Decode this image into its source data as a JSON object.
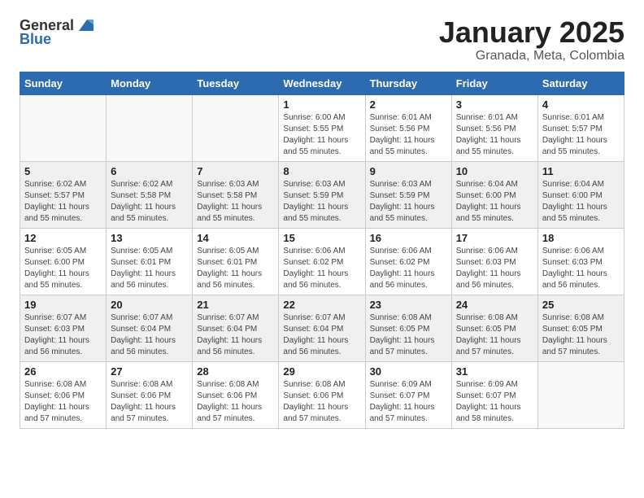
{
  "header": {
    "logo_general": "General",
    "logo_blue": "Blue",
    "month": "January 2025",
    "location": "Granada, Meta, Colombia"
  },
  "weekdays": [
    "Sunday",
    "Monday",
    "Tuesday",
    "Wednesday",
    "Thursday",
    "Friday",
    "Saturday"
  ],
  "weeks": [
    [
      {
        "day": "",
        "info": ""
      },
      {
        "day": "",
        "info": ""
      },
      {
        "day": "",
        "info": ""
      },
      {
        "day": "1",
        "info": "Sunrise: 6:00 AM\nSunset: 5:55 PM\nDaylight: 11 hours\nand 55 minutes."
      },
      {
        "day": "2",
        "info": "Sunrise: 6:01 AM\nSunset: 5:56 PM\nDaylight: 11 hours\nand 55 minutes."
      },
      {
        "day": "3",
        "info": "Sunrise: 6:01 AM\nSunset: 5:56 PM\nDaylight: 11 hours\nand 55 minutes."
      },
      {
        "day": "4",
        "info": "Sunrise: 6:01 AM\nSunset: 5:57 PM\nDaylight: 11 hours\nand 55 minutes."
      }
    ],
    [
      {
        "day": "5",
        "info": "Sunrise: 6:02 AM\nSunset: 5:57 PM\nDaylight: 11 hours\nand 55 minutes."
      },
      {
        "day": "6",
        "info": "Sunrise: 6:02 AM\nSunset: 5:58 PM\nDaylight: 11 hours\nand 55 minutes."
      },
      {
        "day": "7",
        "info": "Sunrise: 6:03 AM\nSunset: 5:58 PM\nDaylight: 11 hours\nand 55 minutes."
      },
      {
        "day": "8",
        "info": "Sunrise: 6:03 AM\nSunset: 5:59 PM\nDaylight: 11 hours\nand 55 minutes."
      },
      {
        "day": "9",
        "info": "Sunrise: 6:03 AM\nSunset: 5:59 PM\nDaylight: 11 hours\nand 55 minutes."
      },
      {
        "day": "10",
        "info": "Sunrise: 6:04 AM\nSunset: 6:00 PM\nDaylight: 11 hours\nand 55 minutes."
      },
      {
        "day": "11",
        "info": "Sunrise: 6:04 AM\nSunset: 6:00 PM\nDaylight: 11 hours\nand 55 minutes."
      }
    ],
    [
      {
        "day": "12",
        "info": "Sunrise: 6:05 AM\nSunset: 6:00 PM\nDaylight: 11 hours\nand 55 minutes."
      },
      {
        "day": "13",
        "info": "Sunrise: 6:05 AM\nSunset: 6:01 PM\nDaylight: 11 hours\nand 56 minutes."
      },
      {
        "day": "14",
        "info": "Sunrise: 6:05 AM\nSunset: 6:01 PM\nDaylight: 11 hours\nand 56 minutes."
      },
      {
        "day": "15",
        "info": "Sunrise: 6:06 AM\nSunset: 6:02 PM\nDaylight: 11 hours\nand 56 minutes."
      },
      {
        "day": "16",
        "info": "Sunrise: 6:06 AM\nSunset: 6:02 PM\nDaylight: 11 hours\nand 56 minutes."
      },
      {
        "day": "17",
        "info": "Sunrise: 6:06 AM\nSunset: 6:03 PM\nDaylight: 11 hours\nand 56 minutes."
      },
      {
        "day": "18",
        "info": "Sunrise: 6:06 AM\nSunset: 6:03 PM\nDaylight: 11 hours\nand 56 minutes."
      }
    ],
    [
      {
        "day": "19",
        "info": "Sunrise: 6:07 AM\nSunset: 6:03 PM\nDaylight: 11 hours\nand 56 minutes."
      },
      {
        "day": "20",
        "info": "Sunrise: 6:07 AM\nSunset: 6:04 PM\nDaylight: 11 hours\nand 56 minutes."
      },
      {
        "day": "21",
        "info": "Sunrise: 6:07 AM\nSunset: 6:04 PM\nDaylight: 11 hours\nand 56 minutes."
      },
      {
        "day": "22",
        "info": "Sunrise: 6:07 AM\nSunset: 6:04 PM\nDaylight: 11 hours\nand 56 minutes."
      },
      {
        "day": "23",
        "info": "Sunrise: 6:08 AM\nSunset: 6:05 PM\nDaylight: 11 hours\nand 57 minutes."
      },
      {
        "day": "24",
        "info": "Sunrise: 6:08 AM\nSunset: 6:05 PM\nDaylight: 11 hours\nand 57 minutes."
      },
      {
        "day": "25",
        "info": "Sunrise: 6:08 AM\nSunset: 6:05 PM\nDaylight: 11 hours\nand 57 minutes."
      }
    ],
    [
      {
        "day": "26",
        "info": "Sunrise: 6:08 AM\nSunset: 6:06 PM\nDaylight: 11 hours\nand 57 minutes."
      },
      {
        "day": "27",
        "info": "Sunrise: 6:08 AM\nSunset: 6:06 PM\nDaylight: 11 hours\nand 57 minutes."
      },
      {
        "day": "28",
        "info": "Sunrise: 6:08 AM\nSunset: 6:06 PM\nDaylight: 11 hours\nand 57 minutes."
      },
      {
        "day": "29",
        "info": "Sunrise: 6:08 AM\nSunset: 6:06 PM\nDaylight: 11 hours\nand 57 minutes."
      },
      {
        "day": "30",
        "info": "Sunrise: 6:09 AM\nSunset: 6:07 PM\nDaylight: 11 hours\nand 57 minutes."
      },
      {
        "day": "31",
        "info": "Sunrise: 6:09 AM\nSunset: 6:07 PM\nDaylight: 11 hours\nand 58 minutes."
      },
      {
        "day": "",
        "info": ""
      }
    ]
  ]
}
